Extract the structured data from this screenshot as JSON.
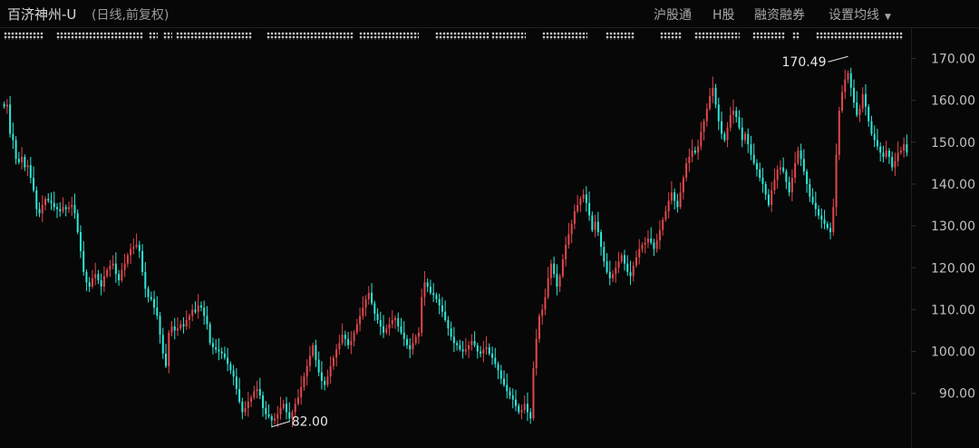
{
  "header": {
    "title": "百济神州-U",
    "subtitle": "(日线,前复权)",
    "nav": [
      "沪股通",
      "H股",
      "融资融券",
      "设置均线"
    ]
  },
  "colors": {
    "background": "#070707",
    "up": "#e0474c",
    "down": "#2ee6d6",
    "axis_text": "#c0c0c0",
    "annotation": "#e8e8e8"
  },
  "chart_data": {
    "type": "candlestick",
    "title": "百济神州-U",
    "y_ticks": [
      "170.00",
      "160.00",
      "150.00",
      "140.00",
      "130.00",
      "120.00",
      "110.00",
      "100.00",
      "90.00"
    ],
    "ylim": [
      82,
      175
    ],
    "grid": false,
    "close_series": [
      158.5,
      159.0,
      152.0,
      150.5,
      146.0,
      145.2,
      146.5,
      144.0,
      144.5,
      141.5,
      138.5,
      134.0,
      133.0,
      135.0,
      136.5,
      136.0,
      135.5,
      134.5,
      134.0,
      133.5,
      134.5,
      134.0,
      134.5,
      135.0,
      133.0,
      128.5,
      124.0,
      119.0,
      116.5,
      115.5,
      117.5,
      118.5,
      117.0,
      115.5,
      118.0,
      119.5,
      120.5,
      121.0,
      118.5,
      117.0,
      119.5,
      121.0,
      123.0,
      124.5,
      125.0,
      125.5,
      124.0,
      119.0,
      115.0,
      113.0,
      112.5,
      110.5,
      108.5,
      104.0,
      99.5,
      96.5,
      104.5,
      106.0,
      105.0,
      105.5,
      106.5,
      106.0,
      107.5,
      108.5,
      110.0,
      109.5,
      111.0,
      110.5,
      108.5,
      106.5,
      102.0,
      101.0,
      100.5,
      100.0,
      99.5,
      98.5,
      97.0,
      95.5,
      94.0,
      91.0,
      88.0,
      85.5,
      86.5,
      88.0,
      89.0,
      90.5,
      91.0,
      89.5,
      86.5,
      85.0,
      84.5,
      83.5,
      84.0,
      85.0,
      86.5,
      87.5,
      85.5,
      84.0,
      85.5,
      87.5,
      89.0,
      91.5,
      94.0,
      96.5,
      99.0,
      101.5,
      98.0,
      95.0,
      93.0,
      92.0,
      94.0,
      96.5,
      98.5,
      100.5,
      102.0,
      104.0,
      103.0,
      101.5,
      102.5,
      104.5,
      106.5,
      108.5,
      110.5,
      112.5,
      114.0,
      111.5,
      109.0,
      107.5,
      106.0,
      104.5,
      105.5,
      106.5,
      107.5,
      108.0,
      106.0,
      104.5,
      103.0,
      101.5,
      100.5,
      102.0,
      103.5,
      104.5,
      113.0,
      116.5,
      115.5,
      114.0,
      113.5,
      112.5,
      111.0,
      109.5,
      107.5,
      105.5,
      103.5,
      102.0,
      101.5,
      100.5,
      100.0,
      100.5,
      101.5,
      102.5,
      101.5,
      100.0,
      99.5,
      100.5,
      101.0,
      99.5,
      98.5,
      97.0,
      95.5,
      93.5,
      92.0,
      90.5,
      89.5,
      88.5,
      87.0,
      85.5,
      86.0,
      87.5,
      85.5,
      84.0,
      96.0,
      103.0,
      108.5,
      110.0,
      113.0,
      117.5,
      121.0,
      118.5,
      115.5,
      118.0,
      122.0,
      125.5,
      128.0,
      130.5,
      133.5,
      135.0,
      136.5,
      137.5,
      135.5,
      132.5,
      129.0,
      131.0,
      128.5,
      125.0,
      121.5,
      119.0,
      117.5,
      118.5,
      120.0,
      121.5,
      123.0,
      121.0,
      119.0,
      118.0,
      120.5,
      122.5,
      124.5,
      125.5,
      126.0,
      127.0,
      126.0,
      124.5,
      126.5,
      129.0,
      131.5,
      133.5,
      136.0,
      138.0,
      136.0,
      134.5,
      138.0,
      141.5,
      145.0,
      146.5,
      148.0,
      147.5,
      149.0,
      152.5,
      155.0,
      158.0,
      161.0,
      163.0,
      159.0,
      155.0,
      152.0,
      150.5,
      153.5,
      156.5,
      157.5,
      156.0,
      153.5,
      150.5,
      152.0,
      149.5,
      147.0,
      145.0,
      143.5,
      141.5,
      140.0,
      137.5,
      135.0,
      138.5,
      141.0,
      143.5,
      144.0,
      143.0,
      140.5,
      138.0,
      141.5,
      145.0,
      148.0,
      146.0,
      143.0,
      140.0,
      137.0,
      135.5,
      134.0,
      132.5,
      131.5,
      130.5,
      129.5,
      128.5,
      134.5,
      147.0,
      157.5,
      162.0,
      165.0,
      166.5,
      163.0,
      159.5,
      156.5,
      158.0,
      161.5,
      158.5,
      155.0,
      152.0,
      150.5,
      149.0,
      147.5,
      146.5,
      148.0,
      146.5,
      144.0,
      145.5,
      147.5,
      148.0,
      149.5,
      147.5
    ],
    "annotations": [
      {
        "text": "170.49",
        "value": 170.49,
        "label_side": "left"
      },
      {
        "text": "82.00",
        "value": 82.0,
        "label_side": "right"
      }
    ]
  }
}
